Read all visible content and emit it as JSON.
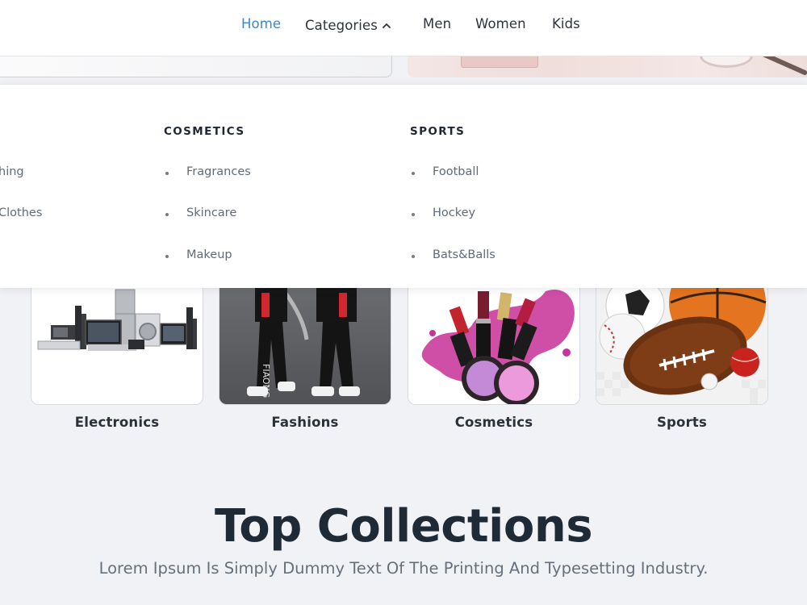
{
  "nav": {
    "items": [
      {
        "label": "Home",
        "active": true
      },
      {
        "label": "Categories",
        "active": false,
        "icon": "chevron-up-icon"
      },
      {
        "label": "Men",
        "active": false
      },
      {
        "label": "Women",
        "active": false
      },
      {
        "label": "Kids",
        "active": false
      }
    ],
    "active_color": "#3a87c8"
  },
  "mega_menu": {
    "columns": [
      {
        "heading": "",
        "items": [
          "hing",
          "Clothes"
        ]
      },
      {
        "heading": "COSMETICS",
        "items": [
          "Fragrances",
          "Skincare",
          "Makeup"
        ]
      },
      {
        "heading": "SPORTS",
        "items": [
          "Football",
          "Hockey",
          "Bats&Balls"
        ]
      }
    ]
  },
  "categories": [
    {
      "label": "Electronics",
      "image": "electronics-image"
    },
    {
      "label": "Fashions",
      "image": "fashion-image"
    },
    {
      "label": "Cosmetics",
      "image": "cosmetics-image"
    },
    {
      "label": "Sports",
      "image": "sports-balls-image"
    }
  ],
  "collections": {
    "title": "Top Collections",
    "subtitle": "Lorem Ipsum Is Simply Dummy Text Of The Printing And Typesetting Industry."
  }
}
